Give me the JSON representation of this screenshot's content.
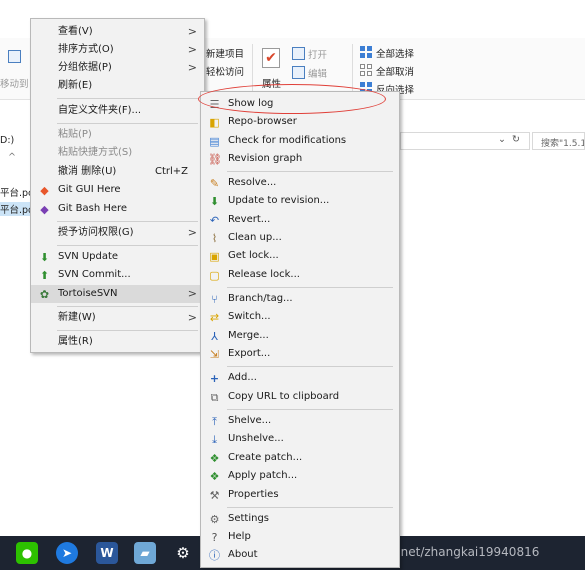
{
  "colors": {
    "taskbar": "#1d2431",
    "menu_bg": "#f2f2f2",
    "highlight_ring": "#e0413a",
    "accent": "#3c7ed4"
  },
  "ribbon": {
    "move_to": "移动到",
    "new_item": "新建项目",
    "easy_access": "轻松访问",
    "properties": "属性",
    "open": "打开",
    "edit": "编辑",
    "select_all": "全部选择",
    "select_none": "全部取消",
    "invert_selection": "反向选择"
  },
  "explorer": {
    "address_prefix": "D:)",
    "search_placeholder": "搜索\"1.5.1",
    "files": [
      "平台.pc",
      "平台.pd"
    ]
  },
  "context_menu": {
    "view": "查看(V)",
    "sort_by": "排序方式(O)",
    "group_by": "分组依据(P)",
    "refresh": "刷新(E)",
    "customize_folder": "自定义文件夹(F)...",
    "paste": "粘贴(P)",
    "paste_shortcut": "粘贴快捷方式(S)",
    "undo_delete": "撤消 删除(U)",
    "undo_shortcut": "Ctrl+Z",
    "git_gui": "Git GUI Here",
    "git_bash": "Git Bash Here",
    "grant_access": "授予访问权限(G)",
    "svn_update": "SVN Update",
    "svn_commit": "SVN Commit...",
    "tortoise_svn": "TortoiseSVN",
    "new": "新建(W)",
    "properties": "属性(R)"
  },
  "submenu": {
    "show_log": "Show log",
    "repo_browser": "Repo-browser",
    "check_mods": "Check for modifications",
    "revision_graph": "Revision graph",
    "resolve": "Resolve...",
    "update_to_revision": "Update to revision...",
    "revert": "Revert...",
    "clean_up": "Clean up...",
    "get_lock": "Get lock...",
    "release_lock": "Release lock...",
    "branch_tag": "Branch/tag...",
    "switch": "Switch...",
    "merge": "Merge...",
    "export": "Export...",
    "add": "Add...",
    "copy_url": "Copy URL to clipboard",
    "shelve": "Shelve...",
    "unshelve": "Unshelve...",
    "create_patch": "Create patch...",
    "apply_patch": "Apply patch...",
    "properties": "Properties",
    "settings": "Settings",
    "help": "Help",
    "about": "About"
  },
  "watermark": "https://blog.csdn.net/zhangkai19940816"
}
